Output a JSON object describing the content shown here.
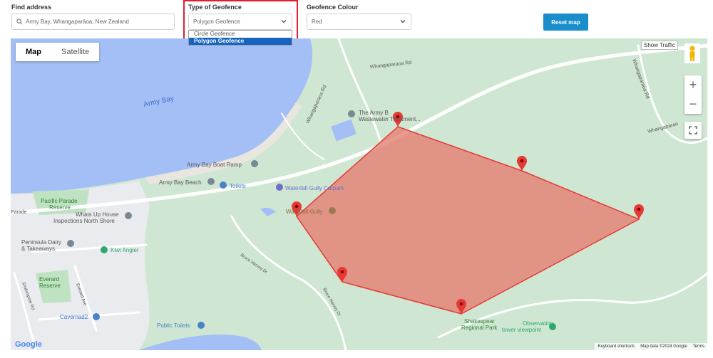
{
  "form": {
    "address_label": "Find address",
    "address_value": "Army Bay, Whangaparāoa, New Zealand",
    "type_label": "Type of Geofence",
    "type_value": "Polygon Geofence",
    "type_options": [
      "Circle Geofence",
      "Polygon Geofence"
    ],
    "colour_label": "Geofence Colour",
    "colour_value": "Red",
    "reset_label": "Reset map"
  },
  "map": {
    "maptype_map": "Map",
    "maptype_satellite": "Satellite",
    "show_traffic": "Show Traffic",
    "zoom_in": "+",
    "zoom_out": "−",
    "google_logo": "Google",
    "footer": [
      "Keyboard shortcuts",
      "Map data ©2024 Google",
      "Terms"
    ],
    "polygon_color": "#e53935",
    "labels": {
      "army_bay": "Army Bay",
      "whangaparaoa_rd_top": "Whangaparaoa Rd",
      "whangaparaoa_rd_left": "Whangaparaoa Rd",
      "whangaparaoa_rd_right": "Whangaparaoa Rd",
      "whangaparaoa_rd_far": "Whangaparao",
      "wastewater_1": "The Army B",
      "wastewater_2": "Wastewater Treatment...",
      "boat_ramp": "Army Bay Boat Ramp",
      "beach": "Army Bay Beach",
      "toilets": "Toilets",
      "carpark": "Waterfall Gully Carpark",
      "waterfall": "Waterfall Gully",
      "pacific_1": "Pacific Parade",
      "pacific_2": "Reserve",
      "parade": "Parade",
      "whats_up_1": "Whats Up House",
      "whats_up_2": "Inspections North Shore",
      "peninsula_1": "Peninsula Dairy",
      "peninsula_2": "& Takeaways",
      "kiwi": "Kiwi Angler",
      "everard_1": "Everard",
      "everard_2": "Reserve",
      "everard_ave": "Everard Ave",
      "shakespear_rd": "Shakespear Rd",
      "cavernad": "Cavernad2",
      "bruce_harvey_1": "Bruce Harvey Dr",
      "bruce_harvey_2": "Bruce Harvey Dr",
      "public_toilets": "Public Toilets",
      "shakespear_park_1": "Shakespear",
      "shakespear_park_2": "Regional Park",
      "observation_1": "Observation",
      "observation_2": "tower viewpoint"
    }
  }
}
